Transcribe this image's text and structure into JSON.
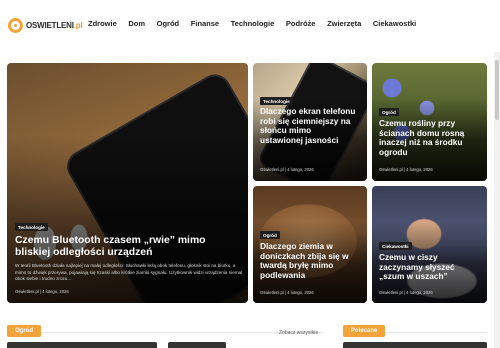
{
  "site": {
    "logo_text": "OSWIETLENI",
    "logo_tld": ".pl"
  },
  "nav": [
    "Zdrowie",
    "Dom",
    "Ogród",
    "Finanse",
    "Technologie",
    "Podróże",
    "Zwierzęta",
    "Ciekawostki"
  ],
  "featured": {
    "tag": "Technologie",
    "title": "Czemu Bluetooth czasem „rwie” mimo bliskiej odległości urządzeń",
    "excerpt": "W teorii Bluetooth działa najlepiej na małej odległości: Słuchawki leżą obok telefonu, głośnik stoi na biurku, a mimo to dźwięk przerywa, pojawiają się trzaski albo krótkie ziarnki sygnału. Użytkownik widzi urządzenia niemal obok siebie i trudno zrozu...",
    "author": "Oswietleni.pl",
    "date": "4 lutego, 2026"
  },
  "cards": [
    {
      "tag": "Technologie",
      "title": "Dlaczego ekran telefonu robi się ciemniejszy na słońcu mimo ustawionej jasności",
      "author": "Oswietleni.pl",
      "date": "4 lutego, 2026"
    },
    {
      "tag": "Ogród",
      "title": "Czemu rośliny przy ścianach domu rosną inaczej niż na środku ogrodu",
      "author": "Oswietleni.pl",
      "date": "4 lutego, 2026"
    },
    {
      "tag": "Ogród",
      "title": "Dlaczego ziemia w doniczkach zbija się w twardą bryłę mimo podlewania",
      "author": "Oswietleni.pl",
      "date": "4 lutego, 2026"
    },
    {
      "tag": "Ciekawostki",
      "title": "Czemu w ciszy zaczynamy słyszeć „szum w uszach”",
      "author": "Oswietleni.pl",
      "date": "4 lutego, 2026"
    }
  ],
  "sections": {
    "left_label": "Ogród",
    "see_all": "Zobacz wszystkie",
    "right_label": "Polecane"
  }
}
